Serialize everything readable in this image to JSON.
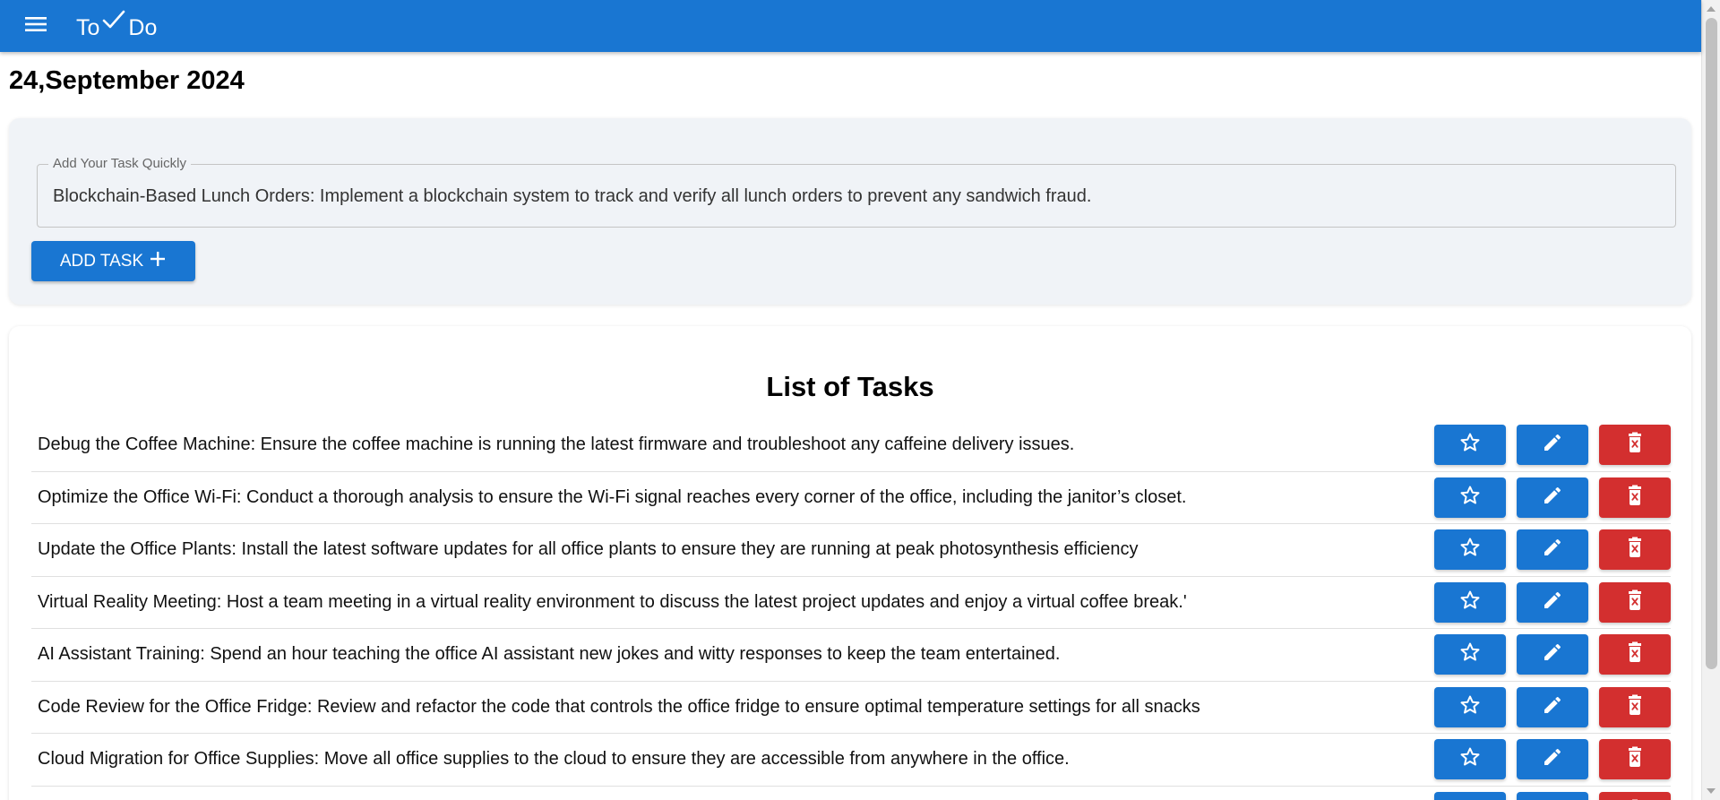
{
  "header": {
    "brand_left": "To",
    "brand_right": "Do",
    "accent": "#1976d2",
    "icons": {
      "menu": "menu-icon",
      "brand": "check-icon"
    }
  },
  "page": {
    "date": "24,September 2024"
  },
  "quick_add": {
    "label": "Add Your Task Quickly",
    "value": "Blockchain-Based Lunch Orders: Implement a blockchain system to track and verify all lunch orders to prevent any sandwich fraud.",
    "button_label": "ADD TASK",
    "button_icon": "plus-icon"
  },
  "task_list": {
    "title": "List of Tasks",
    "action_icons": {
      "favorite": "star-icon",
      "edit": "pencil-icon",
      "delete": "trash-icon"
    },
    "action_colors": {
      "primary": "#1976d2",
      "danger": "#d32f2f"
    },
    "tasks": [
      "Debug the Coffee Machine: Ensure the coffee machine is running the latest firmware and troubleshoot any caffeine delivery issues.",
      "Optimize the Office Wi-Fi: Conduct a thorough analysis to ensure the Wi-Fi signal reaches every corner of the office, including the janitor’s closet.",
      "Update the Office Plants: Install the latest software updates for all office plants to ensure they are running at peak photosynthesis efficiency",
      "Virtual Reality Meeting: Host a team meeting in a virtual reality environment to discuss the latest project updates and enjoy a virtual coffee break.'",
      "AI Assistant Training: Spend an hour teaching the office AI assistant new jokes and witty responses to keep the team entertained.",
      "Code Review for the Office Fridge: Review and refactor the code that controls the office fridge to ensure optimal temperature settings for all snacks",
      "Cloud Migration for Office Supplies: Move all office supplies to the cloud to ensure they are accessible from anywhere in the office.",
      ""
    ]
  }
}
